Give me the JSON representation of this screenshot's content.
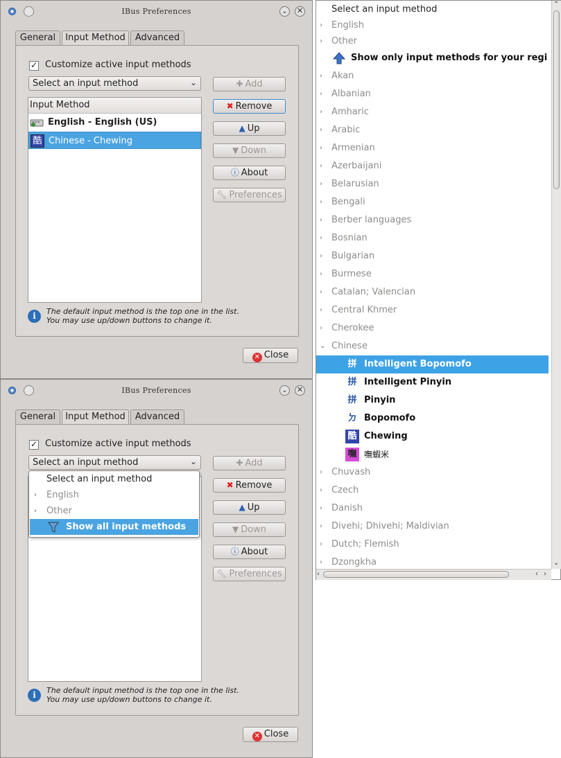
{
  "window_title": "IBus Preferences",
  "tabs": [
    "General",
    "Input Method",
    "Advanced"
  ],
  "customize_label": "Customize active input methods",
  "combo_placeholder": "Select an input method",
  "list_header": "Input Method",
  "active_methods": [
    {
      "label": "English - English (US)",
      "icon": "keyboard-icon"
    },
    {
      "label": "Chinese - Chewing",
      "icon": "chewing-icon"
    }
  ],
  "buttons": {
    "add": "Add",
    "remove": "Remove",
    "up": "Up",
    "down": "Down",
    "about": "About",
    "preferences": "Preferences"
  },
  "info_line1": "The default input method is the top one in the list.",
  "info_line2": "You may use up/down buttons to change it.",
  "close_label": "Close",
  "popup": {
    "items": [
      "Select an input method",
      "English",
      "Other",
      "Show all input methods"
    ]
  },
  "language_list": {
    "title": "Select an input method",
    "english": "English",
    "other": "Other",
    "show_region": "Show only input methods for your regi",
    "languages_before": [
      "Akan",
      "Albanian",
      "Amharic",
      "Arabic",
      "Armenian",
      "Azerbaijani",
      "Belarusian",
      "Bengali",
      "Berber languages",
      "Bosnian",
      "Bulgarian",
      "Burmese",
      "Catalan; Valencian",
      "Central Khmer",
      "Cherokee",
      "Chinese"
    ],
    "chinese_methods": [
      "Intelligent Bopomofo",
      "Intelligent Pinyin",
      "Pinyin",
      "Bopomofo",
      "Chewing",
      "嘸蝦米"
    ],
    "chinese_icons": [
      "拼",
      "拼",
      "拼",
      "ㄉ",
      "酷",
      "嘸"
    ],
    "languages_after": [
      "Chuvash",
      "Czech",
      "Danish",
      "Divehi; Dhivehi; Maldivian",
      "Dutch; Flemish",
      "Dzongkha"
    ]
  },
  "colors": {
    "selection": "#3ea2e6",
    "window_bg": "#d6d2d0"
  }
}
